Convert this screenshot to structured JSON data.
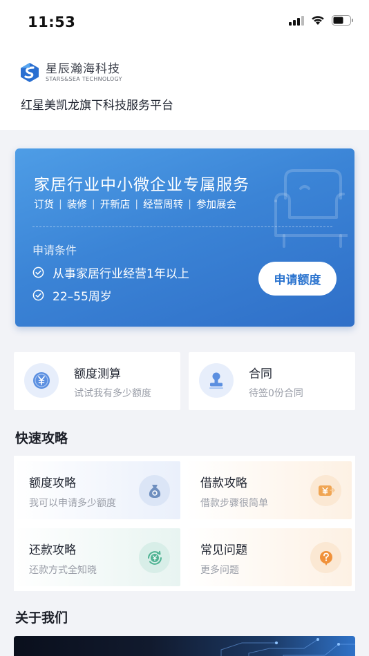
{
  "status_bar": {
    "time": "11:53"
  },
  "brand": {
    "logo_cn": "星辰瀚海科技",
    "logo_en": "STARS&SEA TECHNOLOGY",
    "slogan": "红星美凯龙旗下科技服务平台"
  },
  "hero": {
    "title": "家居行业中小微企业专属服务",
    "tags": [
      "订货",
      "装修",
      "开新店",
      "经营周转",
      "参加展会"
    ],
    "conditions_title": "申请条件",
    "conditions": [
      "从事家居行业经营1年以上",
      "22–55周岁"
    ],
    "apply_button": "申请额度"
  },
  "features": [
    {
      "title": "额度测算",
      "subtitle": "试试我有多少额度",
      "icon": "yen-coin-icon"
    },
    {
      "title": "合同",
      "subtitle": "待签0份合同",
      "icon": "stamp-icon"
    }
  ],
  "quick_guide": {
    "section_title": "快速攻略",
    "items": [
      {
        "title": "额度攻略",
        "subtitle": "我可以申请多少额度",
        "icon": "money-bag-icon"
      },
      {
        "title": "借款攻略",
        "subtitle": "借款步骤很简单",
        "icon": "yen-transfer-icon"
      },
      {
        "title": "还款攻略",
        "subtitle": "还款方式全知晓",
        "icon": "repay-cycle-icon"
      },
      {
        "title": "常见问题",
        "subtitle": "更多问题",
        "icon": "question-icon"
      }
    ]
  },
  "about": {
    "section_title": "关于我们"
  },
  "colors": {
    "primary": "#3b84d6",
    "page_bg": "#f2f3f7",
    "text_muted": "#9a9ea8"
  }
}
